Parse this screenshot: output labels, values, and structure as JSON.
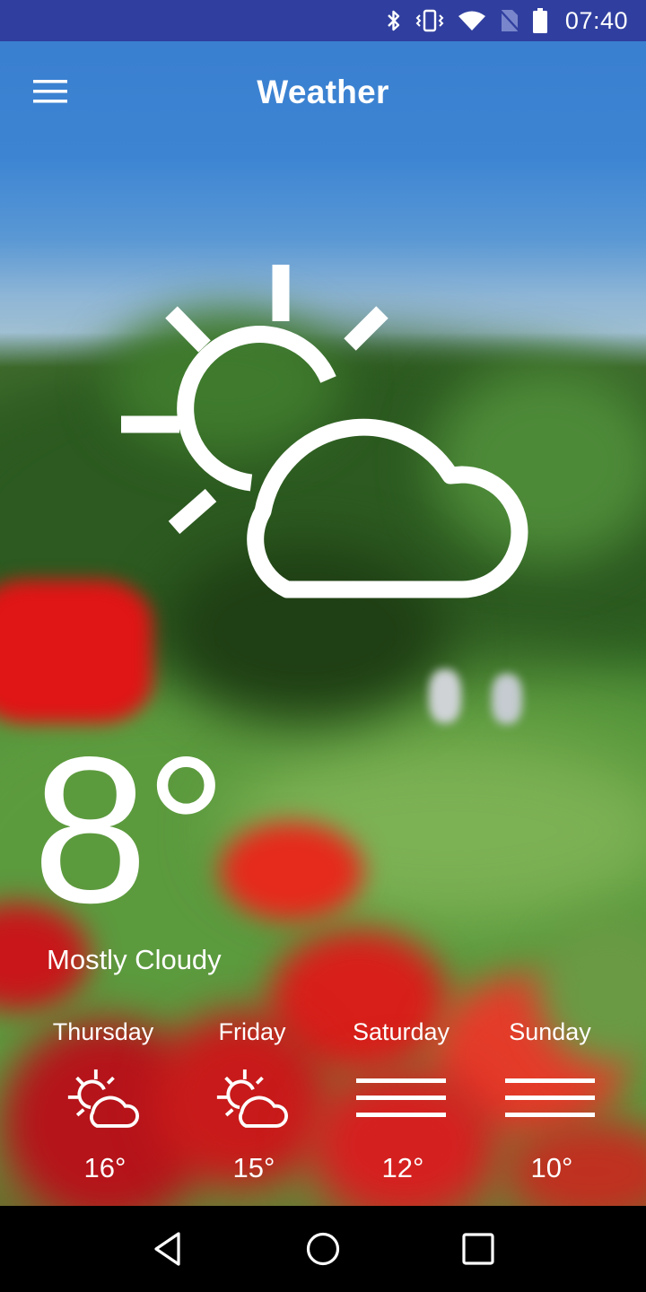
{
  "status_bar": {
    "time": "07:40",
    "icons": [
      "bluetooth-icon",
      "vibrate-icon",
      "wifi-icon",
      "no-sim-icon",
      "battery-icon"
    ],
    "background": "#303f9f"
  },
  "app_bar": {
    "title": "Weather",
    "menu_icon": "hamburger-menu-icon"
  },
  "current": {
    "icon": "partly-cloudy-icon",
    "temperature": "8°",
    "condition": "Mostly Cloudy"
  },
  "forecast": [
    {
      "day": "Thursday",
      "icon": "partly-cloudy-icon",
      "temperature": "16°"
    },
    {
      "day": "Friday",
      "icon": "partly-cloudy-icon",
      "temperature": "15°"
    },
    {
      "day": "Saturday",
      "icon": "fog-icon",
      "temperature": "12°"
    },
    {
      "day": "Sunday",
      "icon": "fog-icon",
      "temperature": "10°"
    }
  ],
  "nav_bar": {
    "buttons": [
      "back-icon",
      "home-icon",
      "recents-icon"
    ]
  }
}
